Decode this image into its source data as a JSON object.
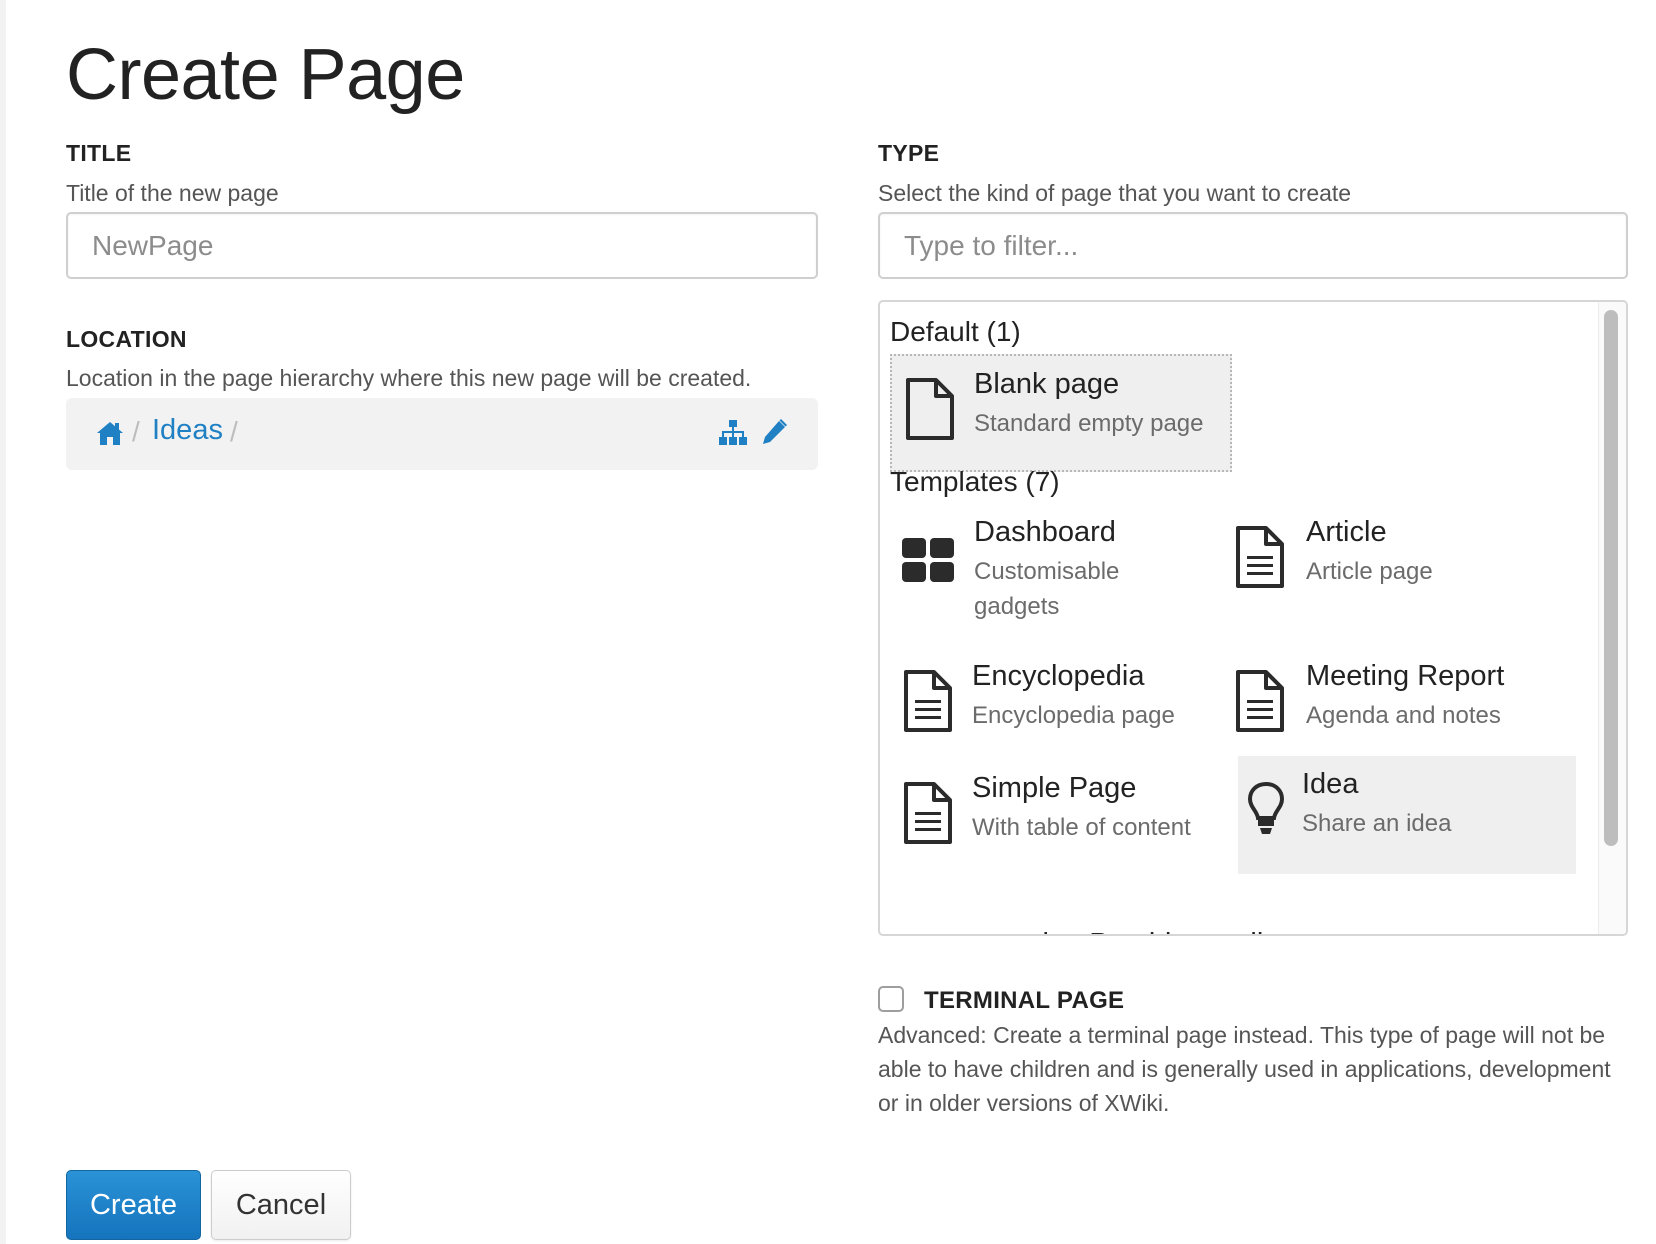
{
  "page": {
    "title": "Create Page"
  },
  "title_field": {
    "label": "TITLE",
    "hint": "Title of the new page",
    "placeholder": "NewPage",
    "value": ""
  },
  "location": {
    "label": "LOCATION",
    "hint": "Location in the page hierarchy where this new page will be created.",
    "separator": "/",
    "crumb": "Ideas",
    "icons": [
      "home-icon",
      "sitemap-icon",
      "pencil-icon"
    ]
  },
  "type_field": {
    "label": "TYPE",
    "hint": "Select the kind of page that you want to create",
    "filter_placeholder": "Type to filter...",
    "groups": [
      {
        "heading": "Default (1)",
        "items": [
          {
            "name": "Blank page",
            "desc": "Standard empty page",
            "icon": "blank-page-icon",
            "state": "selected"
          }
        ]
      },
      {
        "heading": "Templates (7)",
        "items": [
          {
            "name": "Dashboard",
            "desc": "Customisable gadgets",
            "icon": "dashboard-icon"
          },
          {
            "name": "Article",
            "desc": "Article page",
            "icon": "document-icon"
          },
          {
            "name": "Encyclopedia",
            "desc": "Encyclopedia page",
            "icon": "document-icon"
          },
          {
            "name": "Meeting Report",
            "desc": "Agenda and notes",
            "icon": "document-icon"
          },
          {
            "name": "Simple Page",
            "desc": "With table of content",
            "icon": "document-icon"
          },
          {
            "name": "Idea",
            "desc": "Share an idea",
            "icon": "lightbulb-icon",
            "state": "hovered"
          },
          {
            "name": "templateProvider.xpoll.name",
            "desc": "",
            "icon": "poll-icon"
          }
        ]
      }
    ]
  },
  "terminal": {
    "label": "TERMINAL PAGE",
    "checked": false,
    "desc": "Advanced: Create a terminal page instead. This type of page will not be able to have children and is generally used in applications, development or in older versions of XWiki."
  },
  "actions": {
    "create_label": "Create",
    "cancel_label": "Cancel"
  },
  "colors": {
    "link": "#1f80c3",
    "primary": "#1a7fc7",
    "icon": "#2b2b2b"
  }
}
